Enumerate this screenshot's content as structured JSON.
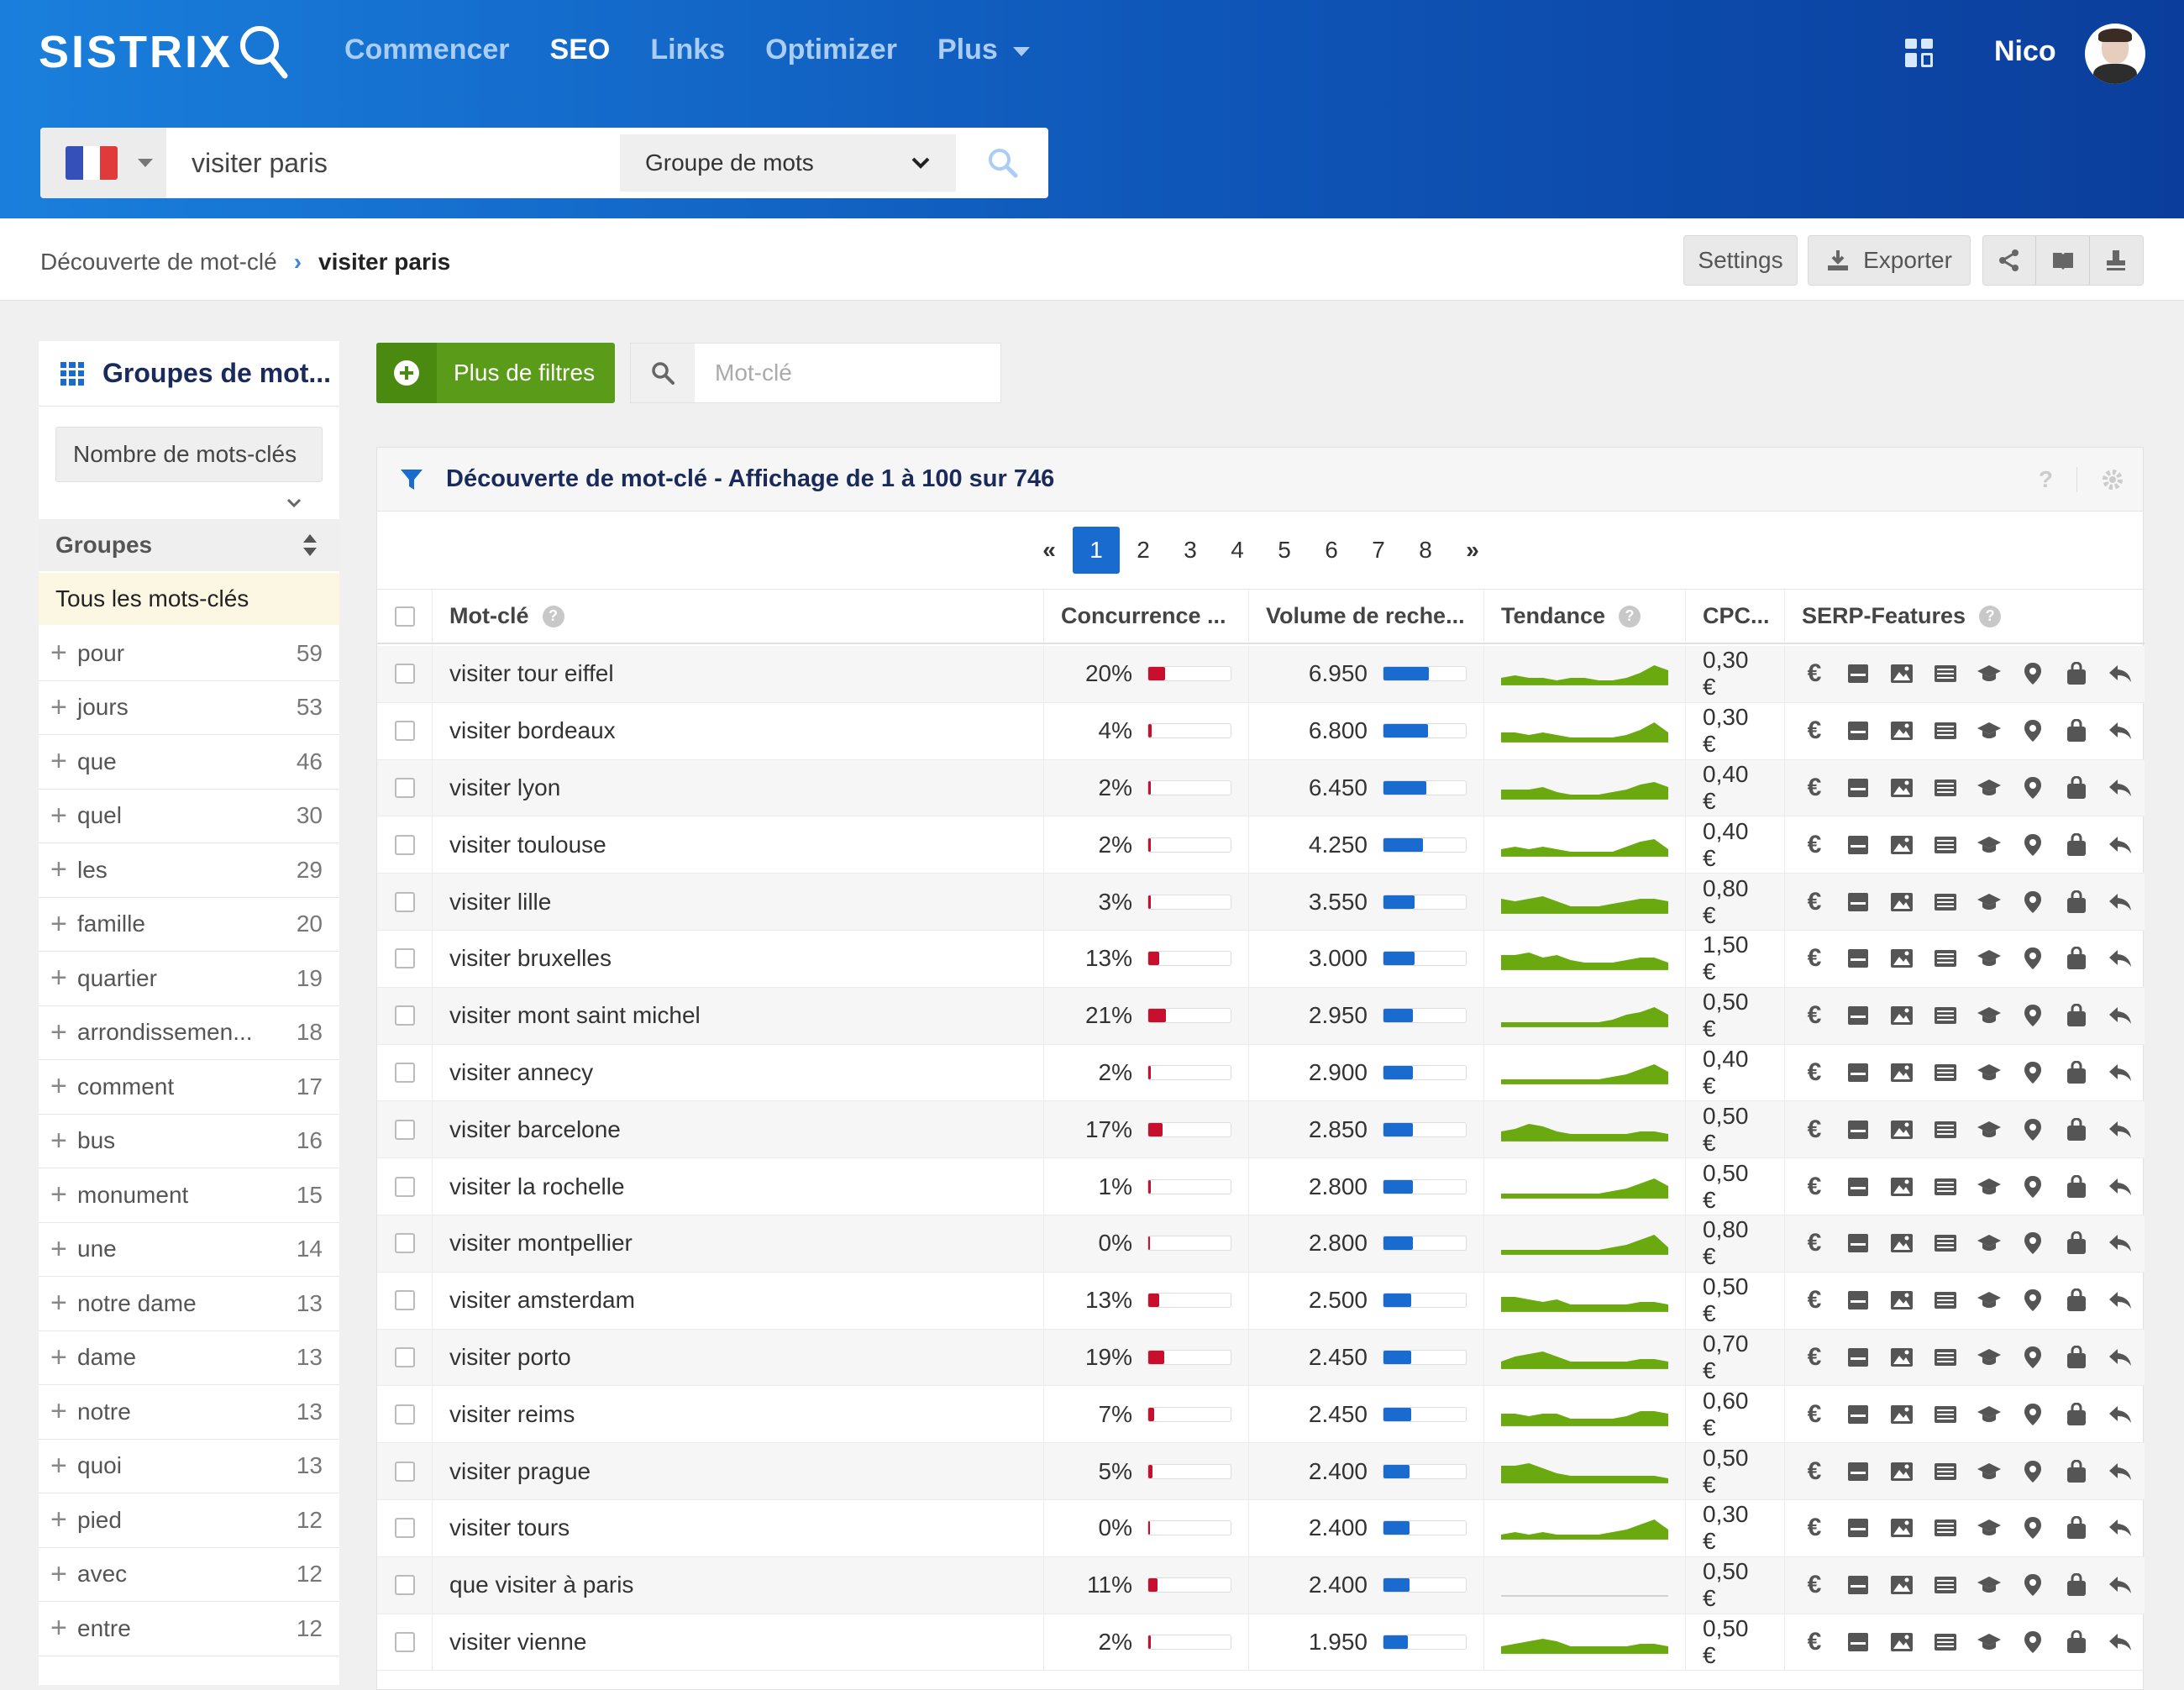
{
  "app": {
    "logo": "SISTRIX",
    "user": "Nico"
  },
  "nav": [
    "Commencer",
    "SEO",
    "Links",
    "Optimizer",
    "Plus"
  ],
  "search": {
    "query": "visiter paris",
    "mode": "Groupe de mots"
  },
  "breadcrumb": {
    "parent": "Découverte de mot-clé",
    "current": "visiter paris"
  },
  "toolbar": {
    "settings": "Settings",
    "export": "Exporter"
  },
  "sidebar": {
    "title": "Groupes de mot...",
    "sort": "Nombre de mots-clés",
    "header": "Groupes",
    "all": "Tous les mots-clés",
    "groups": [
      {
        "name": "pour",
        "count": "59"
      },
      {
        "name": "jours",
        "count": "53"
      },
      {
        "name": "que",
        "count": "46"
      },
      {
        "name": "quel",
        "count": "30"
      },
      {
        "name": "les",
        "count": "29"
      },
      {
        "name": "famille",
        "count": "20"
      },
      {
        "name": "quartier",
        "count": "19"
      },
      {
        "name": "arrondissemen...",
        "count": "18"
      },
      {
        "name": "comment",
        "count": "17"
      },
      {
        "name": "bus",
        "count": "16"
      },
      {
        "name": "monument",
        "count": "15"
      },
      {
        "name": "une",
        "count": "14"
      },
      {
        "name": "notre dame",
        "count": "13"
      },
      {
        "name": "dame",
        "count": "13"
      },
      {
        "name": "notre",
        "count": "13"
      },
      {
        "name": "quoi",
        "count": "13"
      },
      {
        "name": "pied",
        "count": "12"
      },
      {
        "name": "avec",
        "count": "12"
      },
      {
        "name": "entre",
        "count": "12"
      }
    ]
  },
  "filters": {
    "button": "Plus de filtres",
    "placeholder": "Mot-clé"
  },
  "panel": {
    "title": "Découverte de mot-clé - Affichage de 1 à 100 sur 746",
    "pages": [
      "1",
      "2",
      "3",
      "4",
      "5",
      "6",
      "7",
      "8"
    ],
    "columns": {
      "keyword": "Mot-clé",
      "competition": "Concurrence ...",
      "volume": "Volume de reche...",
      "trend": "Tendance",
      "cpc": "CPC...",
      "serp": "SERP-Features"
    }
  },
  "colors": {
    "competition": "#c8102e",
    "volume": "#1a6bd0",
    "trend": "#6aaa10"
  },
  "rows": [
    {
      "kw": "visiter tour eiffel",
      "comp": "20%",
      "compv": 0.2,
      "vol": "6.950",
      "volv": 0.55,
      "cpc": "0,30 €",
      "trend": [
        3,
        4,
        3,
        3,
        2,
        3,
        3,
        2,
        2,
        3,
        5,
        8,
        6
      ]
    },
    {
      "kw": "visiter bordeaux",
      "comp": "4%",
      "compv": 0.04,
      "vol": "6.800",
      "volv": 0.54,
      "cpc": "0,30 €",
      "trend": [
        4,
        4,
        3,
        4,
        3,
        2,
        2,
        2,
        2,
        3,
        5,
        8,
        4
      ]
    },
    {
      "kw": "visiter lyon",
      "comp": "2%",
      "compv": 0.02,
      "vol": "6.450",
      "volv": 0.52,
      "cpc": "0,40 €",
      "trend": [
        4,
        4,
        4,
        5,
        3,
        2,
        2,
        2,
        3,
        4,
        6,
        7,
        5
      ]
    },
    {
      "kw": "visiter toulouse",
      "comp": "2%",
      "compv": 0.02,
      "vol": "4.250",
      "volv": 0.48,
      "cpc": "0,40 €",
      "trend": [
        3,
        4,
        3,
        4,
        3,
        2,
        2,
        2,
        2,
        4,
        6,
        7,
        3
      ]
    },
    {
      "kw": "visiter lille",
      "comp": "3%",
      "compv": 0.03,
      "vol": "3.550",
      "volv": 0.38,
      "cpc": "0,80 €",
      "trend": [
        6,
        5,
        6,
        7,
        5,
        3,
        3,
        3,
        4,
        5,
        6,
        6,
        5
      ]
    },
    {
      "kw": "visiter bruxelles",
      "comp": "13%",
      "compv": 0.13,
      "vol": "3.000",
      "volv": 0.38,
      "cpc": "1,50 €",
      "trend": [
        6,
        6,
        7,
        5,
        6,
        4,
        3,
        3,
        3,
        4,
        5,
        5,
        3
      ]
    },
    {
      "kw": "visiter mont saint michel",
      "comp": "21%",
      "compv": 0.21,
      "vol": "2.950",
      "volv": 0.36,
      "cpc": "0,50 €",
      "trend": [
        2,
        2,
        2,
        2,
        2,
        2,
        2,
        2,
        3,
        5,
        6,
        8,
        5
      ]
    },
    {
      "kw": "visiter annecy",
      "comp": "2%",
      "compv": 0.02,
      "vol": "2.900",
      "volv": 0.36,
      "cpc": "0,40 €",
      "trend": [
        2,
        2,
        2,
        2,
        2,
        2,
        2,
        2,
        3,
        4,
        6,
        8,
        5
      ]
    },
    {
      "kw": "visiter barcelone",
      "comp": "17%",
      "compv": 0.17,
      "vol": "2.850",
      "volv": 0.36,
      "cpc": "0,50 €",
      "trend": [
        4,
        5,
        7,
        6,
        4,
        3,
        3,
        3,
        3,
        3,
        4,
        4,
        3
      ]
    },
    {
      "kw": "visiter la rochelle",
      "comp": "1%",
      "compv": 0.01,
      "vol": "2.800",
      "volv": 0.36,
      "cpc": "0,50 €",
      "trend": [
        2,
        2,
        2,
        2,
        2,
        2,
        2,
        2,
        3,
        4,
        6,
        8,
        5
      ]
    },
    {
      "kw": "visiter montpellier",
      "comp": "0%",
      "compv": 0.0,
      "vol": "2.800",
      "volv": 0.36,
      "cpc": "0,80 €",
      "trend": [
        2,
        2,
        2,
        2,
        2,
        2,
        2,
        2,
        3,
        4,
        6,
        8,
        3
      ]
    },
    {
      "kw": "visiter amsterdam",
      "comp": "13%",
      "compv": 0.13,
      "vol": "2.500",
      "volv": 0.34,
      "cpc": "0,50 €",
      "trend": [
        6,
        6,
        5,
        4,
        5,
        3,
        3,
        3,
        3,
        3,
        4,
        4,
        3
      ]
    },
    {
      "kw": "visiter porto",
      "comp": "19%",
      "compv": 0.19,
      "vol": "2.450",
      "volv": 0.34,
      "cpc": "0,70 €",
      "trend": [
        3,
        5,
        6,
        7,
        5,
        3,
        3,
        3,
        3,
        3,
        4,
        4,
        3
      ]
    },
    {
      "kw": "visiter reims",
      "comp": "7%",
      "compv": 0.07,
      "vol": "2.450",
      "volv": 0.34,
      "cpc": "0,60 €",
      "trend": [
        5,
        5,
        4,
        5,
        5,
        3,
        3,
        3,
        3,
        4,
        6,
        6,
        5
      ]
    },
    {
      "kw": "visiter prague",
      "comp": "5%",
      "compv": 0.05,
      "vol": "2.400",
      "volv": 0.32,
      "cpc": "0,50 €",
      "trend": [
        7,
        7,
        8,
        6,
        4,
        3,
        3,
        3,
        3,
        3,
        3,
        3,
        2
      ]
    },
    {
      "kw": "visiter tours",
      "comp": "0%",
      "compv": 0.0,
      "vol": "2.400",
      "volv": 0.32,
      "cpc": "0,30 €",
      "trend": [
        2,
        3,
        2,
        3,
        2,
        2,
        2,
        2,
        3,
        4,
        6,
        8,
        4
      ]
    },
    {
      "kw": "que visiter à paris",
      "comp": "11%",
      "compv": 0.11,
      "vol": "2.400",
      "volv": 0.32,
      "cpc": "0,50 €",
      "trend": [
        0,
        0,
        0,
        0,
        0,
        0,
        0,
        0,
        0,
        0,
        0,
        0,
        0
      ]
    },
    {
      "kw": "visiter vienne",
      "comp": "2%",
      "compv": 0.02,
      "vol": "1.950",
      "volv": 0.3,
      "cpc": "0,50 €",
      "trend": [
        3,
        4,
        5,
        6,
        5,
        3,
        3,
        3,
        3,
        3,
        4,
        4,
        3
      ]
    }
  ]
}
